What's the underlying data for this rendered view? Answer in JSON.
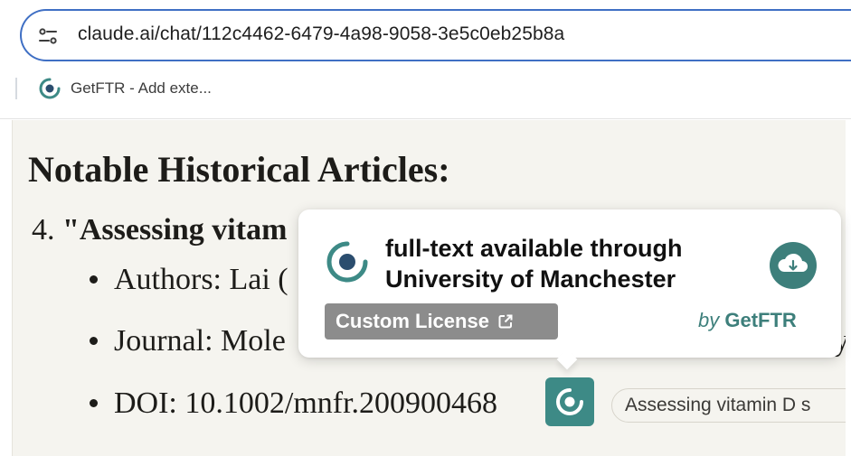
{
  "browser": {
    "url": "claude.ai/chat/112c4462-6479-4a98-9058-3e5c0eb25b8a",
    "bookmark_label": "GetFTR - Add exte..."
  },
  "content": {
    "heading": "Notable Historical Articles:",
    "item_number": "4.",
    "item_title": "\"Assessing vitam",
    "authors": "Authors: Lai (",
    "journal": "Journal: Mole",
    "journal_tail": "y",
    "doi": "DOI: 10.1002/mnfr.200900468",
    "title_chip": "Assessing vitamin D s"
  },
  "popup": {
    "line1": "full-text available through",
    "line2": "University of Manchester",
    "license": "Custom License",
    "by_word": "by",
    "brand": "GetFTR"
  },
  "colors": {
    "accent": "#3d8a86",
    "address_border": "#3f6fc4",
    "badge_gray": "#8c8c8c",
    "page_bg": "#f5f4ef"
  },
  "icons": {
    "address_bar": "tune-icon",
    "bookmark": "getftr-icon",
    "popup_logo": "getftr-logo-icon",
    "download": "cloud-download-icon",
    "license_link": "external-link-icon"
  }
}
